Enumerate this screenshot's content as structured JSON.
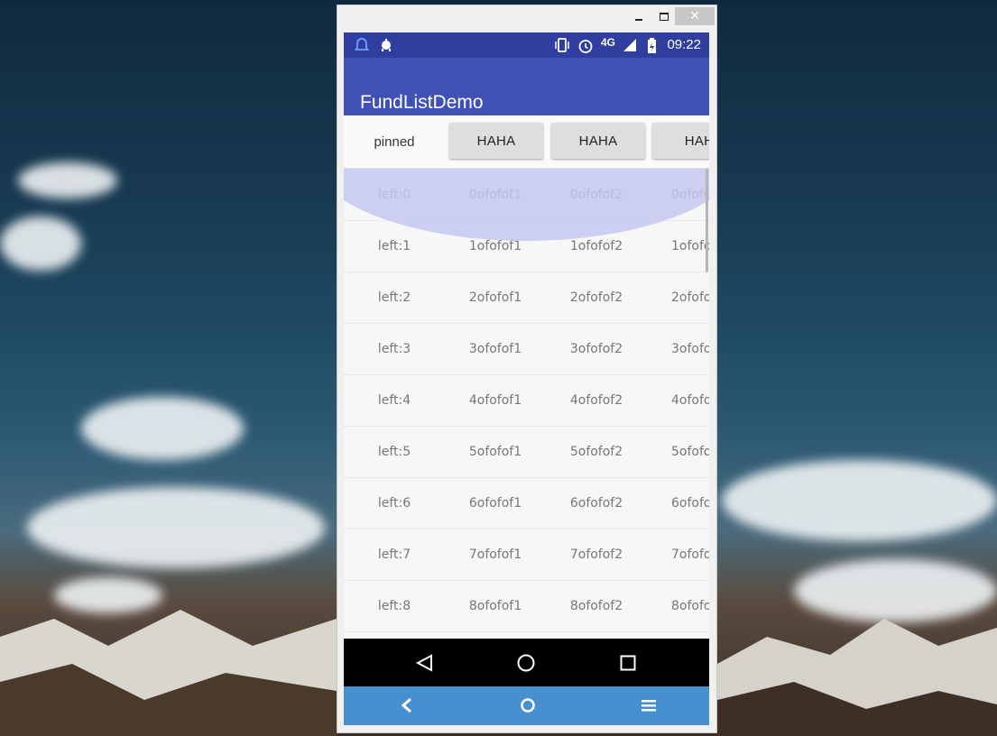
{
  "app": {
    "title": "FundListDemo"
  },
  "status_bar": {
    "time": "09:22",
    "network": "4G",
    "icons": [
      "notification-icon",
      "android-debug-icon",
      "vibrate-icon",
      "alarm-icon",
      "signal-icon",
      "battery-icon"
    ]
  },
  "window": {
    "minimize_icon": "minimize-icon",
    "maximize_icon": "maximize-icon",
    "close_label": "✕"
  },
  "header": {
    "pinned_label": "pinned",
    "buttons": [
      "HAHA",
      "HAHA",
      "HAH"
    ]
  },
  "list": {
    "rows": [
      {
        "left": "left:0",
        "col1": "0ofofof1",
        "col2": "0ofofof2",
        "col3": "0ofofo"
      },
      {
        "left": "left:1",
        "col1": "1ofofof1",
        "col2": "1ofofof2",
        "col3": "1ofofo"
      },
      {
        "left": "left:2",
        "col1": "2ofofof1",
        "col2": "2ofofof2",
        "col3": "2ofofo"
      },
      {
        "left": "left:3",
        "col1": "3ofofof1",
        "col2": "3ofofof2",
        "col3": "3ofofo"
      },
      {
        "left": "left:4",
        "col1": "4ofofof1",
        "col2": "4ofofof2",
        "col3": "4ofofo"
      },
      {
        "left": "left:5",
        "col1": "5ofofof1",
        "col2": "5ofofof2",
        "col3": "5ofofo"
      },
      {
        "left": "left:6",
        "col1": "6ofofof1",
        "col2": "6ofofof2",
        "col3": "6ofofo"
      },
      {
        "left": "left:7",
        "col1": "7ofofof1",
        "col2": "7ofofof2",
        "col3": "7ofofo"
      },
      {
        "left": "left:8",
        "col1": "8ofofof1",
        "col2": "8ofofof2",
        "col3": "8ofofo"
      }
    ]
  },
  "nav_bar": {
    "icons": [
      "back-triangle-icon",
      "home-circle-icon",
      "recents-square-icon"
    ]
  },
  "host_bar": {
    "icons": [
      "back-chevron-icon",
      "home-ring-icon",
      "menu-icon"
    ]
  },
  "colors": {
    "status_bar": "#303f9f",
    "app_bar": "#3f51b5",
    "host_bar": "#4690cf",
    "overscroll_glow": "#c4c8f0"
  }
}
